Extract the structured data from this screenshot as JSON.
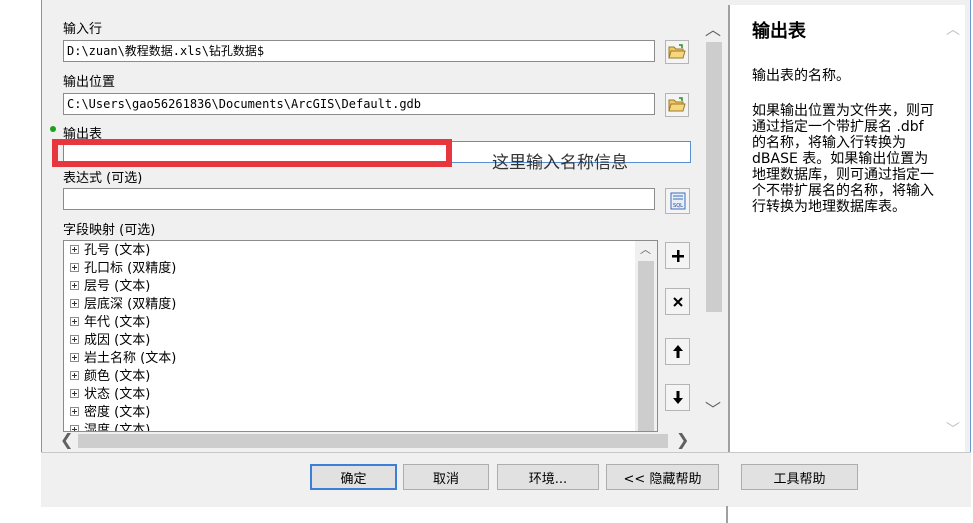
{
  "form": {
    "input_rows_label": "输入行",
    "input_rows_value": "D:\\zuan\\教程数据.xls\\钻孔数据$",
    "output_location_label": "输出位置",
    "output_location_value": "C:\\Users\\gao56261836\\Documents\\ArcGIS\\Default.gdb",
    "output_table_label": "输出表",
    "output_table_value": "",
    "expression_label": "表达式 (可选)",
    "expression_value": "",
    "sql_icon_text": "SQL",
    "field_map_label": "字段映射 (可选)"
  },
  "field_map": {
    "items": [
      "孔号 (文本)",
      "孔口标 (双精度)",
      "层号 (文本)",
      "层底深 (双精度)",
      "年代 (文本)",
      "成因 (文本)",
      "岩土名称 (文本)",
      "颜色 (文本)",
      "状态 (文本)",
      "密度 (文本)",
      "湿度 (文本)"
    ]
  },
  "annotation": {
    "text": "这里输入名称信息",
    "color": "#e8363f"
  },
  "help": {
    "title": "输出表",
    "para1": "输出表的名称。",
    "para2": "如果输出位置为文件夹，则可通过指定一个带扩展名 .dbf 的名称，将输入行转换为 dBASE 表。如果输出位置为地理数据库，则可通过指定一个不带扩展名的名称，将输入行转换为地理数据库表。"
  },
  "buttons": {
    "ok": "确定",
    "cancel": "取消",
    "env": "环境...",
    "hide_help": "<< 隐藏帮助",
    "tool_help": "工具帮助"
  },
  "colors": {
    "default_button_border": "#3c7fd6",
    "required_dot": "#1aa31a"
  }
}
